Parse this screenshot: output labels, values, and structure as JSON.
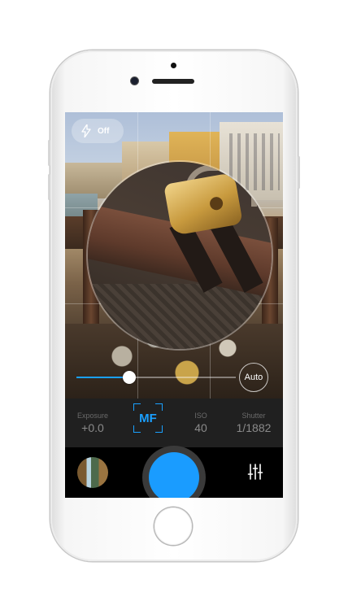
{
  "camera": {
    "flash": {
      "label": "Off",
      "icon": "lightning-bolt-icon"
    },
    "focus": {
      "auto_label": "Auto",
      "slider_fraction": 0.33
    },
    "settings": {
      "exposure": {
        "label": "Exposure",
        "value": "+0.0"
      },
      "mode": {
        "value": "MF"
      },
      "iso": {
        "label": "ISO",
        "value": "40"
      },
      "shutter": {
        "label": "Shutter",
        "value": "1/1882"
      }
    },
    "colors": {
      "accent": "#1a9cff",
      "shutter_button": "#1a9cff"
    },
    "icons": {
      "gallery": "photo-thumbnail",
      "adjust": "sliders-icon"
    }
  }
}
